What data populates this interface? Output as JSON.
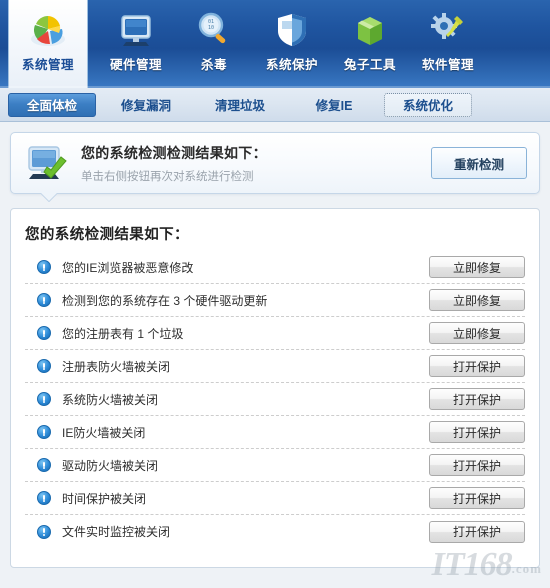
{
  "theme": {
    "header_blue_dark": "#1b4d96",
    "header_blue_light": "#3a79c4",
    "accent_blue": "#2f6fb4",
    "panel_white": "#ffffff",
    "info_icon_blue": "#2d8bd8"
  },
  "toolbar": {
    "items": [
      {
        "label": "系统管理",
        "icon": "pie-chart-icon",
        "active": true
      },
      {
        "label": "硬件管理",
        "icon": "monitor-icon",
        "active": false
      },
      {
        "label": "杀毒",
        "icon": "magnifier-icon",
        "active": false
      },
      {
        "label": "系统保护",
        "icon": "shield-icon",
        "active": false
      },
      {
        "label": "兔子工具",
        "icon": "green-box-icon",
        "active": false
      },
      {
        "label": "软件管理",
        "icon": "gear-wrench-icon",
        "active": false
      }
    ]
  },
  "tabs": [
    {
      "label": "全面体检",
      "state": "active"
    },
    {
      "label": "修复漏洞",
      "state": "normal"
    },
    {
      "label": "清理垃圾",
      "state": "normal"
    },
    {
      "label": "修复IE",
      "state": "normal"
    },
    {
      "label": "系统优化",
      "state": "focused"
    }
  ],
  "notice": {
    "icon": "monitor-check-icon",
    "title": "您的系统检测检测结果如下：",
    "subtitle": "单击右侧按钮再次对系统进行检测",
    "button_label": "重新检测"
  },
  "results": {
    "heading": "您的系统检测结果如下：",
    "rows": [
      {
        "icon": "info-exclamation-icon",
        "text": "您的IE浏览器被恶意修改",
        "action": "立即修复"
      },
      {
        "icon": "info-exclamation-icon",
        "text": "检测到您的系统存在 3 个硬件驱动更新",
        "action": "立即修复"
      },
      {
        "icon": "info-exclamation-icon",
        "text": "您的注册表有 1 个垃圾",
        "action": "立即修复"
      },
      {
        "icon": "info-exclamation-icon",
        "text": "注册表防火墙被关闭",
        "action": "打开保护"
      },
      {
        "icon": "info-exclamation-icon",
        "text": "系统防火墙被关闭",
        "action": "打开保护"
      },
      {
        "icon": "info-exclamation-icon",
        "text": "IE防火墙被关闭",
        "action": "打开保护"
      },
      {
        "icon": "info-exclamation-icon",
        "text": "驱动防火墙被关闭",
        "action": "打开保护"
      },
      {
        "icon": "info-exclamation-icon",
        "text": "时间保护被关闭",
        "action": "打开保护"
      },
      {
        "icon": "info-exclamation-icon",
        "text": "文件实时监控被关闭",
        "action": "打开保护"
      }
    ]
  },
  "watermark": {
    "main": "IT168",
    "suffix": ".com"
  }
}
